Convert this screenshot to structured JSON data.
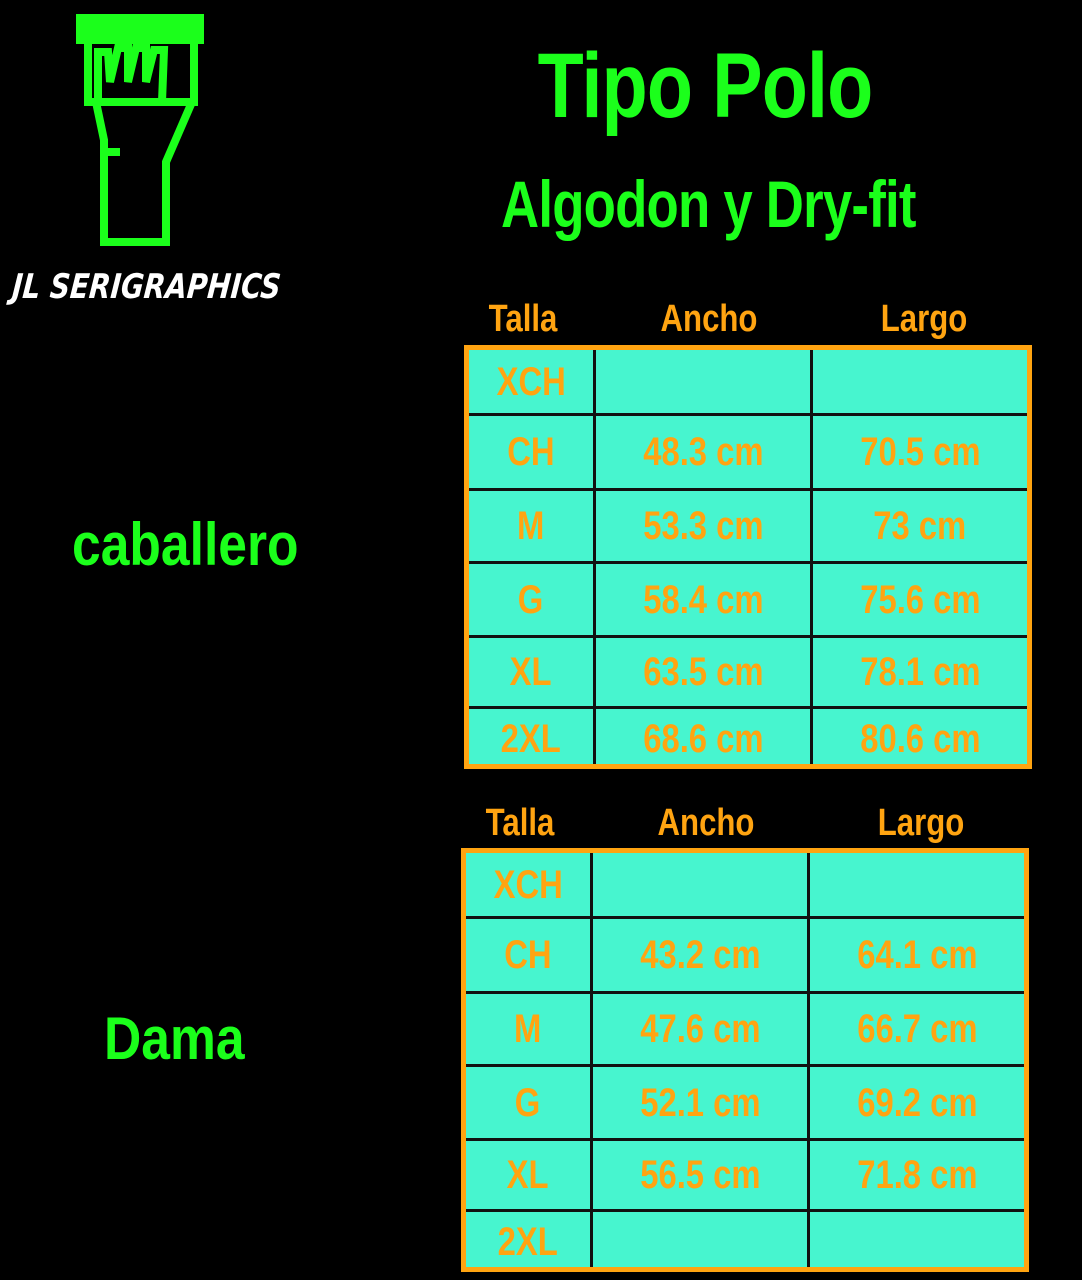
{
  "brand": {
    "name": "JL SERIGRAPHICS"
  },
  "titles": {
    "main": "Tipo Polo",
    "sub": "Algodon y Dry-fit"
  },
  "colors": {
    "background": "#000000",
    "title_green": "#1bff1b",
    "accent_orange": "#ffa411",
    "table_fill": "#47f5cf"
  },
  "tables": [
    {
      "label": "caballero",
      "headers": {
        "size": "Talla",
        "width": "Ancho",
        "length": "Largo"
      },
      "rows": [
        {
          "size": "XCH",
          "width": "",
          "length": ""
        },
        {
          "size": "CH",
          "width": "48.3 cm",
          "length": "70.5 cm"
        },
        {
          "size": "M",
          "width": "53.3 cm",
          "length": "73 cm"
        },
        {
          "size": "G",
          "width": "58.4 cm",
          "length": "75.6 cm"
        },
        {
          "size": "XL",
          "width": "63.5 cm",
          "length": "78.1 cm"
        },
        {
          "size": "2XL",
          "width": "68.6 cm",
          "length": "80.6 cm"
        }
      ]
    },
    {
      "label": "Dama",
      "headers": {
        "size": "Talla",
        "width": "Ancho",
        "length": "Largo"
      },
      "rows": [
        {
          "size": "XCH",
          "width": "",
          "length": ""
        },
        {
          "size": "CH",
          "width": "43.2 cm",
          "length": "64.1 cm"
        },
        {
          "size": "M",
          "width": "47.6 cm",
          "length": "66.7 cm"
        },
        {
          "size": "G",
          "width": "52.1 cm",
          "length": "69.2 cm"
        },
        {
          "size": "XL",
          "width": "56.5 cm",
          "length": "71.8 cm"
        },
        {
          "size": "2XL",
          "width": "",
          "length": ""
        }
      ]
    }
  ]
}
